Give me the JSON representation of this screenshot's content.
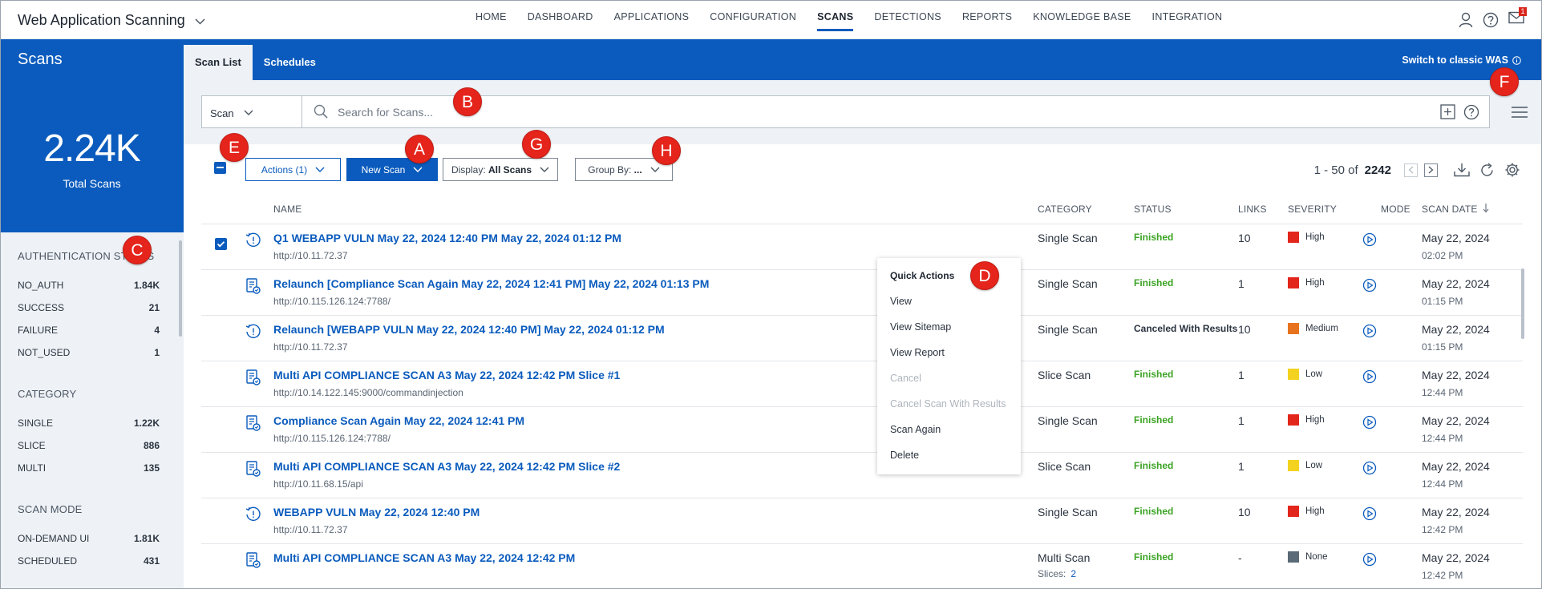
{
  "app": {
    "title": "Web Application Scanning",
    "nav": [
      "HOME",
      "DASHBOARD",
      "APPLICATIONS",
      "CONFIGURATION",
      "SCANS",
      "DETECTIONS",
      "REPORTS",
      "KNOWLEDGE BASE",
      "INTEGRATION"
    ],
    "active_nav": "SCANS",
    "mail_badge": "1"
  },
  "section": {
    "title": "Scans",
    "tabs": [
      "Scan List",
      "Schedules"
    ],
    "switch_classic": "Switch to classic WAS"
  },
  "sidebar": {
    "total_value": "2.24K",
    "total_label": "Total Scans",
    "facets": [
      {
        "title": "AUTHENTICATION STATUS",
        "rows": [
          {
            "label": "NO_AUTH",
            "count": "1.84K"
          },
          {
            "label": "SUCCESS",
            "count": "21"
          },
          {
            "label": "FAILURE",
            "count": "4"
          },
          {
            "label": "NOT_USED",
            "count": "1"
          }
        ]
      },
      {
        "title": "CATEGORY",
        "rows": [
          {
            "label": "SINGLE",
            "count": "1.22K"
          },
          {
            "label": "SLICE",
            "count": "886"
          },
          {
            "label": "MULTI",
            "count": "135"
          }
        ]
      },
      {
        "title": "SCAN MODE",
        "rows": [
          {
            "label": "ON-DEMAND UI",
            "count": "1.81K"
          },
          {
            "label": "SCHEDULED",
            "count": "431"
          }
        ]
      }
    ]
  },
  "search": {
    "scope": "Scan",
    "placeholder": "Search for Scans..."
  },
  "toolbar": {
    "actions_label": "Actions (1)",
    "new_scan_label": "New Scan",
    "display_prefix": "Display:",
    "display_value": "All Scans",
    "group_prefix": "Group By:",
    "group_value": "...",
    "range": "1 - 50 of",
    "total": "2242"
  },
  "table": {
    "headers": {
      "name": "NAME",
      "category": "CATEGORY",
      "status": "STATUS",
      "links": "LINKS",
      "severity": "SEVERITY",
      "mode": "MODE",
      "scan_date": "SCAN DATE"
    },
    "rows": [
      {
        "type": "webapp",
        "checked": true,
        "name": "Q1 WEBAPP VULN May 22, 2024 12:40 PM May 22, 2024 01:12 PM",
        "url": "http://10.11.72.37",
        "category": "Single Scan",
        "status": "Finished",
        "links": "10",
        "severity": "High",
        "date": "May 22, 2024",
        "time": "02:02 PM"
      },
      {
        "type": "compliance",
        "checked": false,
        "name": "Relaunch [Compliance Scan Again May 22, 2024 12:41 PM] May 22, 2024 01:13 PM",
        "url": "http://10.115.126.124:7788/",
        "category": "Single Scan",
        "status": "Finished",
        "links": "1",
        "severity": "High",
        "date": "May 22, 2024",
        "time": "01:15 PM"
      },
      {
        "type": "webapp",
        "checked": false,
        "name": "Relaunch [WEBAPP VULN May 22, 2024 12:40 PM] May 22, 2024 01:12 PM",
        "url": "http://10.11.72.37",
        "category": "Single Scan",
        "status": "Canceled With Results",
        "links": "10",
        "severity": "Medium",
        "date": "May 22, 2024",
        "time": "01:15 PM"
      },
      {
        "type": "compliance",
        "checked": false,
        "name": "Multi API COMPLIANCE SCAN A3 May 22, 2024 12:42 PM Slice #1",
        "url": "http://10.14.122.145:9000/commandinjection",
        "category": "Slice Scan",
        "status": "Finished",
        "links": "1",
        "severity": "Low",
        "date": "May 22, 2024",
        "time": "12:44 PM"
      },
      {
        "type": "compliance",
        "checked": false,
        "name": "Compliance Scan Again May 22, 2024 12:41 PM",
        "url": "http://10.115.126.124:7788/",
        "category": "Single Scan",
        "status": "Finished",
        "links": "1",
        "severity": "High",
        "date": "May 22, 2024",
        "time": "12:44 PM"
      },
      {
        "type": "compliance",
        "checked": false,
        "name": "Multi API COMPLIANCE SCAN A3 May 22, 2024 12:42 PM Slice #2",
        "url": "http://10.11.68.15/api",
        "category": "Slice Scan",
        "status": "Finished",
        "links": "1",
        "severity": "Low",
        "date": "May 22, 2024",
        "time": "12:44 PM"
      },
      {
        "type": "webapp",
        "checked": false,
        "name": "WEBAPP VULN May 22, 2024 12:40 PM",
        "url": "http://10.11.72.37",
        "category": "Single Scan",
        "status": "Finished",
        "links": "10",
        "severity": "High",
        "date": "May 22, 2024",
        "time": "12:42 PM"
      },
      {
        "type": "compliance",
        "checked": false,
        "name": "Multi API COMPLIANCE SCAN A3 May 22, 2024 12:42 PM",
        "url": "",
        "category": "Multi Scan",
        "slices_label": "Slices:",
        "slices_count": "2",
        "status": "Finished",
        "links": "-",
        "severity": "None",
        "date": "May 22, 2024",
        "time": "12:42 PM"
      }
    ]
  },
  "severity_colors": {
    "High": "#e3261c",
    "Medium": "#e8731e",
    "Low": "#f3d320",
    "None": "#5a6a76"
  },
  "quick_actions": {
    "title": "Quick Actions",
    "items": [
      {
        "label": "View",
        "disabled": false
      },
      {
        "label": "View Sitemap",
        "disabled": false
      },
      {
        "label": "View Report",
        "disabled": false
      },
      {
        "label": "Cancel",
        "disabled": true
      },
      {
        "label": "Cancel Scan With Results",
        "disabled": true
      },
      {
        "label": "Scan Again",
        "disabled": false
      },
      {
        "label": "Delete",
        "disabled": false
      }
    ]
  },
  "markers": [
    "A",
    "B",
    "C",
    "D",
    "E",
    "F",
    "G",
    "H"
  ]
}
